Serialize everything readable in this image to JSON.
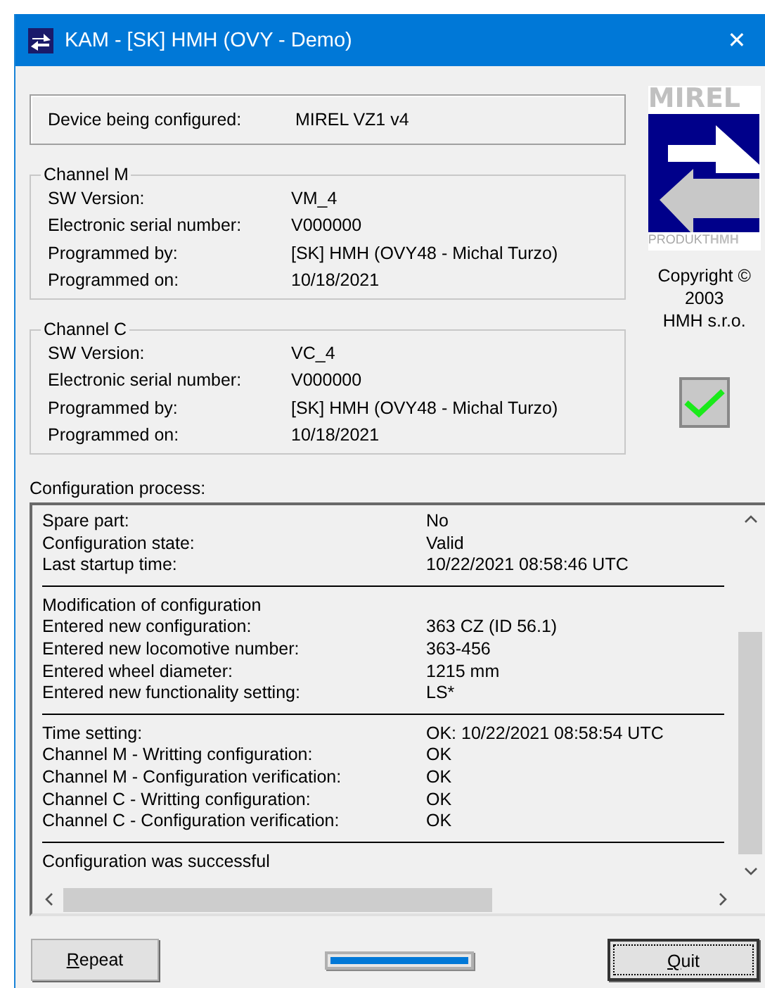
{
  "window": {
    "title": "KAM - [SK] HMH (OVY - Demo)",
    "close": "✕"
  },
  "device": {
    "label": "Device being configured:",
    "value": "MIREL VZ1 v4"
  },
  "channels": [
    {
      "title": "Channel M",
      "rows": [
        {
          "label": "SW Version:",
          "value": "VM_4"
        },
        {
          "label": "Electronic serial number:",
          "value": "V000000"
        },
        {
          "label": "Programmed by:",
          "value": "[SK] HMH (OVY48 - Michal Turzo)"
        },
        {
          "label": "Programmed on:",
          "value": "10/18/2021"
        }
      ]
    },
    {
      "title": "Channel C",
      "rows": [
        {
          "label": "SW Version:",
          "value": "VC_4"
        },
        {
          "label": "Electronic serial number:",
          "value": "V000000"
        },
        {
          "label": "Programmed by:",
          "value": "[SK] HMH (OVY48 - Michal Turzo)"
        },
        {
          "label": "Programmed on:",
          "value": "10/18/2021"
        }
      ]
    }
  ],
  "logo": {
    "brand": "MIREL",
    "footer": "PRODUKT",
    "footer_mark": "HMH"
  },
  "copyright": [
    "Copyright ©",
    "2003",
    "HMH s.r.o."
  ],
  "status": {
    "ok": true
  },
  "log": {
    "title": "Configuration process:",
    "sections": [
      {
        "rows": [
          {
            "label": "Spare part:",
            "value": "No"
          },
          {
            "label": "Configuration state:",
            "value": "Valid"
          },
          {
            "label": "Last startup time:",
            "value": "10/22/2021 08:58:46 UTC"
          }
        ]
      },
      {
        "rows": [
          {
            "label": "Modification of configuration"
          },
          {
            "label": "Entered new configuration:",
            "value": "363 CZ (ID 56.1)"
          },
          {
            "label": "Entered new locomotive number:",
            "value": "363-456"
          },
          {
            "label": "Entered wheel diameter:",
            "value": "1215 mm"
          },
          {
            "label": "Entered new functionality setting:",
            "value": "LS*"
          }
        ]
      },
      {
        "rows": [
          {
            "label": "Time setting:",
            "value": "OK: 10/22/2021 08:58:54 UTC"
          },
          {
            "label": "Channel M - Writting configuration:",
            "value": "OK"
          },
          {
            "label": "Channel M - Configuration verification:",
            "value": "OK"
          },
          {
            "label": "Channel C - Writting configuration:",
            "value": "OK"
          },
          {
            "label": "Channel C - Configuration verification:",
            "value": "OK"
          }
        ]
      },
      {
        "rows": [
          {
            "label": "Configuration was successful"
          }
        ]
      }
    ]
  },
  "progress": {
    "level": 1
  },
  "buttons": [
    {
      "label": "Repeat",
      "mnemonic": true,
      "focused": false
    },
    {
      "label": "Quit",
      "mnemonic": true,
      "focused": true
    }
  ]
}
